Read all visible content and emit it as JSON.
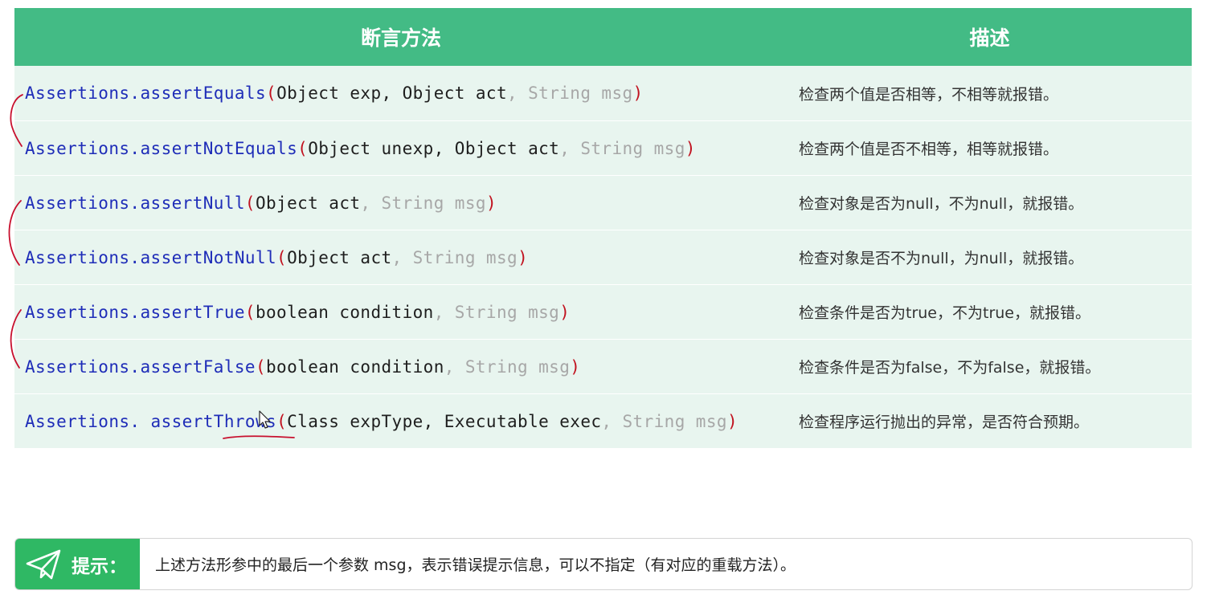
{
  "table": {
    "headers": {
      "method": "断言方法",
      "description": "描述"
    },
    "rows": [
      {
        "cls": "Assertions.",
        "method": "assertEquals",
        "lp": "(",
        "args": "Object exp, Object act",
        "opt": ", String msg",
        "rp": ")",
        "desc": "检查两个值是否相等，不相等就报错。"
      },
      {
        "cls": "Assertions.",
        "method": "assertNotEquals",
        "lp": "(",
        "args": "Object unexp, Object act",
        "opt": ", String msg",
        "rp": ")",
        "desc": "检查两个值是否不相等，相等就报错。"
      },
      {
        "cls": "Assertions.",
        "method": "assertNull",
        "lp": "(",
        "args": "Object act",
        "opt": ", String msg",
        "rp": ")",
        "desc": "检查对象是否为null，不为null，就报错。"
      },
      {
        "cls": "Assertions.",
        "method": "assertNotNull",
        "lp": "(",
        "args": "Object act",
        "opt": ", String msg",
        "rp": ")",
        "desc": "检查对象是否不为null，为null，就报错。"
      },
      {
        "cls": "Assertions.",
        "method": "assertTrue",
        "lp": "(",
        "args": "boolean condition",
        "opt": ", String msg",
        "rp": ")",
        "desc": "检查条件是否为true，不为true，就报错。"
      },
      {
        "cls": "Assertions.",
        "method": "assertFalse",
        "lp": "(",
        "args": "boolean condition",
        "opt": ", String msg",
        "rp": ")",
        "desc": "检查条件是否为false，不为false，就报错。"
      },
      {
        "cls": "Assertions. ",
        "method": "assertThrows",
        "lp": "(",
        "args": "Class expType, Executable exec",
        "opt": ", String msg",
        "rp": ")",
        "desc": "检查程序运行抛出的异常，是否符合预期。"
      }
    ]
  },
  "tip": {
    "icon": "paper-plane-icon",
    "title": "提示：",
    "text": "上述方法形参中的最后一个参数 msg，表示错误提示信息，可以不指定（有对应的重载方法）。"
  },
  "colors": {
    "header_bg": "#43bb85",
    "row_bg": "#e8f5ef",
    "class_blue": "#1f2db8",
    "paren_red": "#c1121f",
    "optional_gray": "#a7a7a7",
    "annotation_red": "#c8102e",
    "tip_green": "#2fb864"
  }
}
